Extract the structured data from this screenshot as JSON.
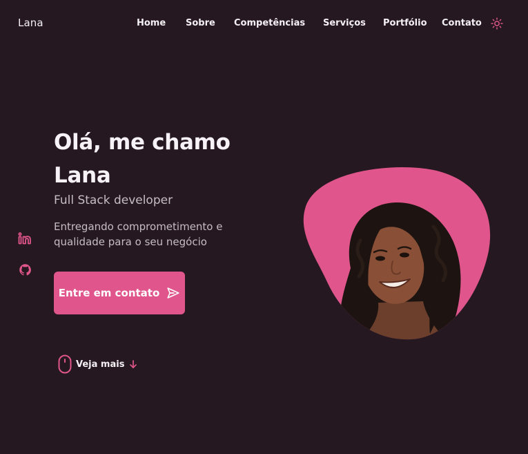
{
  "header": {
    "logo": "Lana",
    "nav": [
      {
        "label": "Home"
      },
      {
        "label": "Sobre"
      },
      {
        "label": "Competências"
      },
      {
        "label": "Serviços"
      },
      {
        "label": "Portfólio"
      },
      {
        "label": "Contato"
      }
    ],
    "theme_icon": "sun-icon"
  },
  "socials": [
    {
      "icon": "linkedin-icon"
    },
    {
      "icon": "github-icon"
    }
  ],
  "hero": {
    "title": "Olá, me chamo Lana",
    "subtitle": "Full Stack developer",
    "description": "Entregando comprometimento e qualidade para o seu negócio",
    "cta_label": "Entre em contato",
    "cta_icon": "send-icon",
    "scroll_label": "Veja mais",
    "scroll_icons": [
      "mouse-icon",
      "arrow-down-icon"
    ]
  },
  "colors": {
    "background": "#261820",
    "accent": "#e0568c",
    "text": "#f4f0f3",
    "muted_text": "#c6bcc3"
  }
}
